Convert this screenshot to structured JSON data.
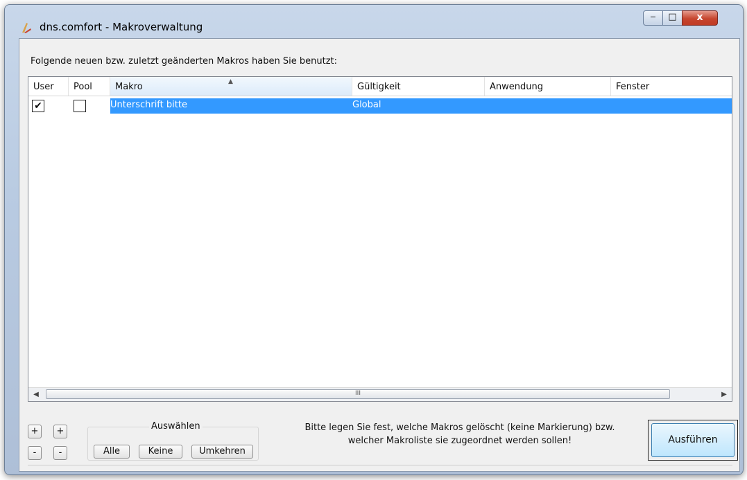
{
  "window": {
    "title": "dns.comfort - Makroverwaltung",
    "controls": {
      "minimize": "‒",
      "maximize": "□",
      "close": "x"
    }
  },
  "intro_text": "Folgende neuen bzw. zuletzt geänderten Makros haben Sie benutzt:",
  "table": {
    "columns": [
      "User",
      "Pool",
      "Makro",
      "Gültigkeit",
      "Anwendung",
      "Fenster"
    ],
    "sorted_column": "Makro",
    "rows": [
      {
        "user": true,
        "pool": false,
        "makro": "Unterschrift bitte",
        "gueltigkeit": "Global",
        "anwendung": "",
        "fenster": "",
        "selected": true
      }
    ],
    "scrollbar_thumb_glyph": "III"
  },
  "bottom": {
    "plus_1": "+",
    "plus_2": "+",
    "minus_1": "-",
    "minus_2": "-",
    "select_group_label": "Auswählen",
    "btn_all": "Alle",
    "btn_none": "Keine",
    "btn_invert": "Umkehren",
    "info_line_1": "Bitte legen Sie fest, welche Makros gelöscht (keine Markierung) bzw.",
    "info_line_2": "welcher Makroliste sie zugeordnet werden sollen!",
    "run_button": "Ausführen"
  },
  "colors": {
    "selection": "#3399ff",
    "titlebar": "#b9cbe2",
    "close_button": "#c7462f"
  }
}
